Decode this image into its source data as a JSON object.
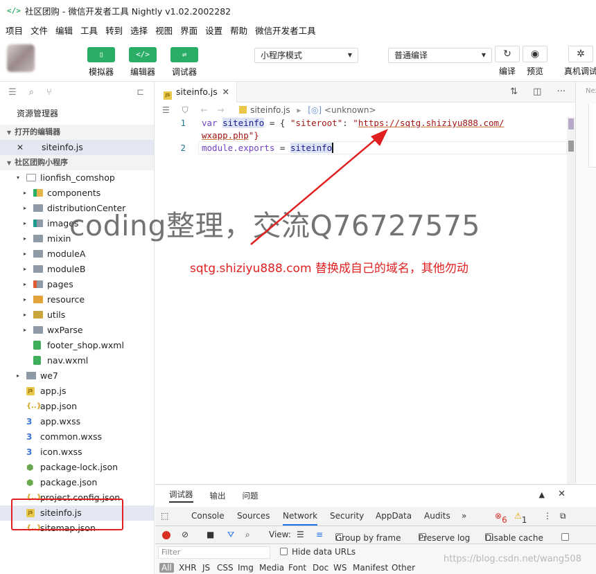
{
  "window": {
    "logo": "</>",
    "title": "社区团购 - 微信开发者工具 Nightly v1.02.2002282"
  },
  "menu": [
    "项目",
    "文件",
    "编辑",
    "工具",
    "转到",
    "选择",
    "视图",
    "界面",
    "设置",
    "帮助",
    "微信开发者工具"
  ],
  "toolbar": {
    "simulator": "模拟器",
    "editor": "编辑器",
    "debugger": "调试器",
    "mode_select": "小程序模式",
    "compile_select": "普通编译",
    "compile": "编译",
    "preview": "预览",
    "device_debug": "真机调试"
  },
  "sidebar": {
    "title": "资源管理器",
    "open_editors": "打开的编辑器",
    "open_file": "siteinfo.js",
    "project": "社区团购小程序",
    "tree": [
      {
        "label": "lionfish_comshop",
        "icon": "folder-open",
        "level": 1,
        "arrow": "▾"
      },
      {
        "label": "components",
        "icon": "green",
        "level": 2,
        "arrow": "▸"
      },
      {
        "label": "distributionCenter",
        "icon": "grey",
        "level": 2,
        "arrow": "▸"
      },
      {
        "label": "images",
        "icon": "teal",
        "level": 2,
        "arrow": "▸"
      },
      {
        "label": "mixin",
        "icon": "grey",
        "level": 2,
        "arrow": "▸"
      },
      {
        "label": "moduleA",
        "icon": "grey",
        "level": 2,
        "arrow": "▸"
      },
      {
        "label": "moduleB",
        "icon": "grey",
        "level": 2,
        "arrow": "▸"
      },
      {
        "label": "pages",
        "icon": "red",
        "level": 2,
        "arrow": "▸"
      },
      {
        "label": "resource",
        "icon": "orange",
        "level": 2,
        "arrow": "▸"
      },
      {
        "label": "utils",
        "icon": "yellow",
        "level": 2,
        "arrow": "▸"
      },
      {
        "label": "wxParse",
        "icon": "grey",
        "level": 2,
        "arrow": "▸"
      },
      {
        "label": "footer_shop.wxml",
        "icon": "wxml",
        "level": 2,
        "arrow": ""
      },
      {
        "label": "nav.wxml",
        "icon": "wxml",
        "level": 2,
        "arrow": ""
      },
      {
        "label": "we7",
        "icon": "grey",
        "level": 1,
        "arrow": "▸"
      },
      {
        "label": "app.js",
        "icon": "js",
        "level": 1,
        "arrow": ""
      },
      {
        "label": "app.json",
        "icon": "json",
        "level": 1,
        "arrow": ""
      },
      {
        "label": "app.wxss",
        "icon": "css",
        "level": 1,
        "arrow": ""
      },
      {
        "label": "common.wxss",
        "icon": "css",
        "level": 1,
        "arrow": ""
      },
      {
        "label": "icon.wxss",
        "icon": "css",
        "level": 1,
        "arrow": ""
      },
      {
        "label": "package-lock.json",
        "icon": "pkg",
        "level": 1,
        "arrow": ""
      },
      {
        "label": "package.json",
        "icon": "pkg",
        "level": 1,
        "arrow": ""
      },
      {
        "label": "project.config.json",
        "icon": "json",
        "level": 1,
        "arrow": ""
      },
      {
        "label": "siteinfo.js",
        "icon": "js",
        "level": 1,
        "arrow": "",
        "active": true
      },
      {
        "label": "sitemap.json",
        "icon": "json",
        "level": 1,
        "arrow": ""
      }
    ]
  },
  "editor": {
    "tab": "siteinfo.js",
    "breadcrumb_file": "siteinfo.js",
    "breadcrumb_symbol": "<unknown>",
    "lines": [
      {
        "no": "1",
        "kw": "var",
        "name": "siteinfo",
        "eq": " = { ",
        "key": "\"siteroot\"",
        "colon": ": ",
        "quote": "\"",
        "url": "https://sqtg.shiziyu888.com/"
      },
      {
        "no": "",
        "cont_url": "wxapp.php",
        "cont_end": "\"}"
      },
      {
        "no": "2",
        "kw": "module.exports",
        "eq": " = ",
        "name": "siteinfo"
      }
    ],
    "right_panel": "Nex"
  },
  "annotations": {
    "watermark": "coding整理，交流Q76727575",
    "note": "sqtg.shiziyu888.com 替换成自己的域名，其他勿动",
    "arrow_color": "#e02020",
    "site_watermark": "https://blog.csdn.net/wang508"
  },
  "devtools": {
    "tabs": [
      "调试器",
      "输出",
      "问题"
    ],
    "panels": [
      "Console",
      "Sources",
      "Network",
      "Security",
      "AppData",
      "Audits"
    ],
    "more": "»",
    "errors": "6",
    "warnings": "1",
    "view": "View:",
    "group_by_frame": "Group by frame",
    "preserve_log": "Preserve log",
    "disable_cache": "Disable cache",
    "filter_placeholder": "Filter",
    "hide_data_urls": "Hide data URLs",
    "types": [
      "All",
      "XHR",
      "JS",
      "CSS",
      "Img",
      "Media",
      "Font",
      "Doc",
      "WS",
      "Manifest",
      "Other"
    ]
  }
}
